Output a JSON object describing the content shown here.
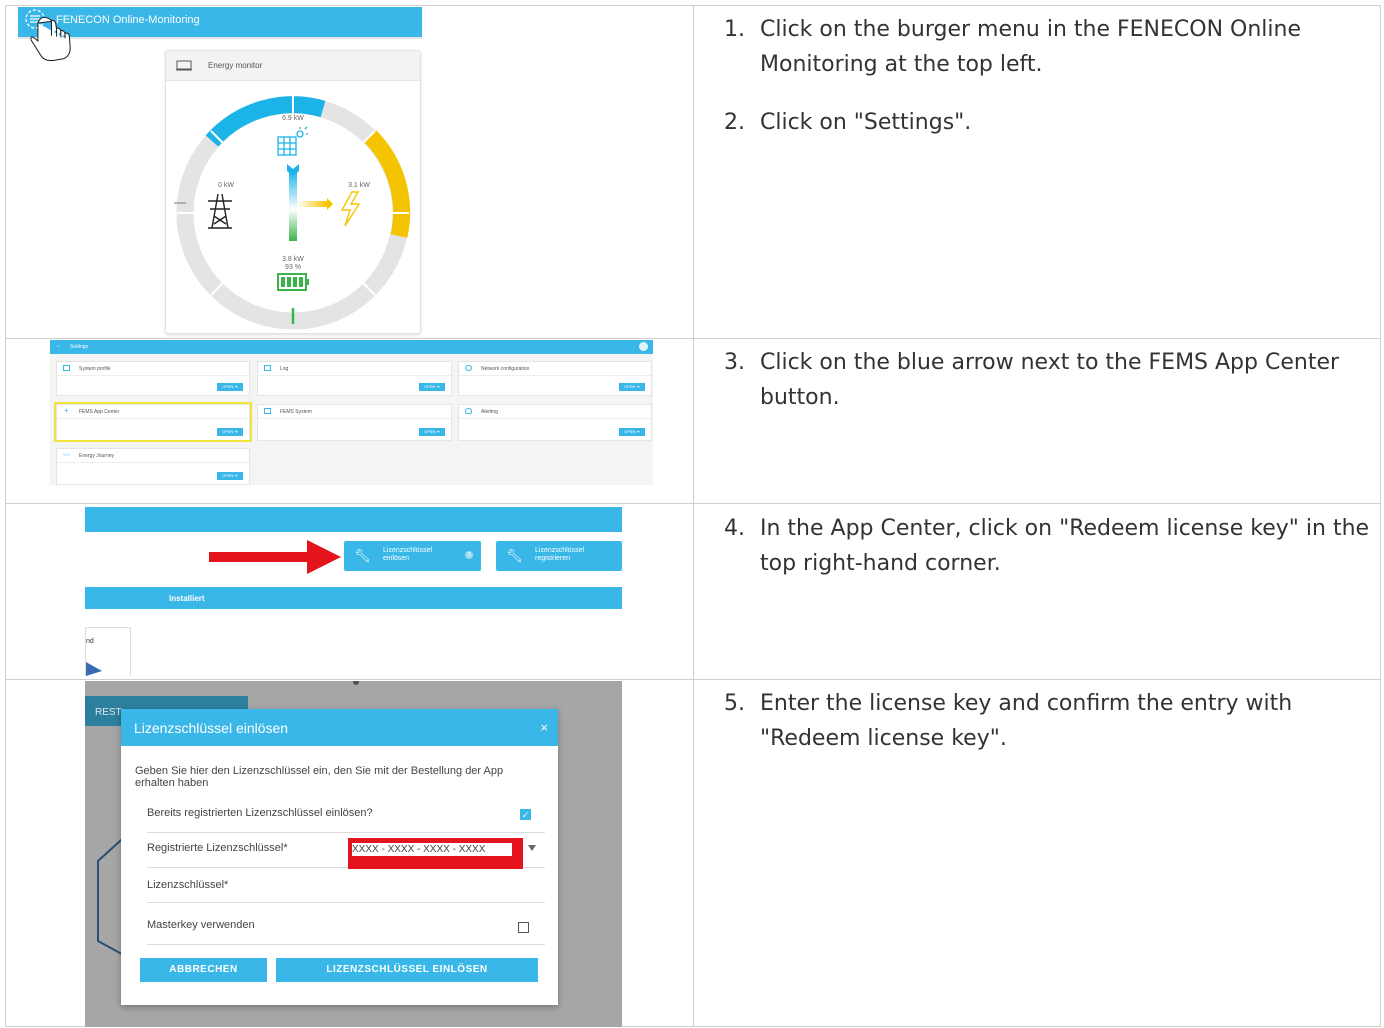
{
  "steps": [
    {
      "num": "1.",
      "text": "Click on the burger menu in the FENECON Online Monitoring at the top left."
    },
    {
      "num": "2.",
      "text": "Click on \"Settings\"."
    },
    {
      "num": "3.",
      "text": "Click on the blue arrow next to the FEMS App Center button."
    },
    {
      "num": "4.",
      "text": "In the App Center, click on \"Redeem license key\" in the top right-hand corner."
    },
    {
      "num": "5.",
      "text": "Enter the license key and confirm the entry with \"Redeem license key\"."
    }
  ],
  "shot1": {
    "app_title": "FENECON Online-Monitoring",
    "card_title": "Energy monitor",
    "pv": "6.9 kW",
    "grid": "0 kW",
    "consumption": "3.1 kW",
    "storage_power": "3.8 kW",
    "storage_soc": "93 %"
  },
  "shot2": {
    "title": "Settings",
    "button": "OPEN ➔",
    "cards": [
      "System profile",
      "Log",
      "Network configuration",
      "FEMS App Center",
      "FEMS System",
      "Alerting",
      "Energy Journey"
    ]
  },
  "shot3": {
    "redeem_label_1": "Lizenzschlüssel",
    "redeem_label_2": "einlösen",
    "register_label_1": "Lizenzschlüssel",
    "register_label_2": "registrieren",
    "badge": "3",
    "installed": "Installiert",
    "side_text": "nd",
    "accent_arrow": "#e3141b"
  },
  "shot4": {
    "background_tab": "REST",
    "dialog_title": "Lizenzschlüssel einlösen",
    "close": "×",
    "intro": "Geben Sie hier den Lizenzschlüssel ein, den Sie mit der Bestellung der App erhalten haben",
    "row1": "Bereits registrierten Lizenzschlüssel einlösen?",
    "row2": "Registrierte Lizenzschlüssel*",
    "row2_value": "XXXX - XXXX - XXXX - XXXX",
    "row3": "Lizenzschlüssel*",
    "row4": "Masterkey verwenden",
    "cancel": "ABBRECHEN",
    "submit": "LIZENZSCHLÜSSEL EINLÖSEN"
  },
  "colors": {
    "primary": "#39b7e8",
    "pv": "#1cb4e8",
    "consumption": "#f5c400",
    "storage": "#3bb34a",
    "highlight_red": "#e3141b"
  }
}
